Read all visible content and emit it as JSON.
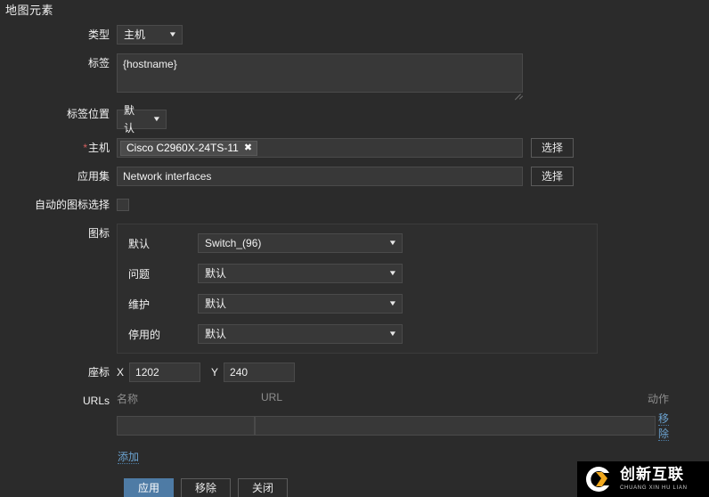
{
  "page": {
    "title": "地图元素"
  },
  "form": {
    "type": {
      "label": "类型",
      "value": "主机"
    },
    "label_field": {
      "label": "标签",
      "value": "{hostname}"
    },
    "label_position": {
      "label": "标签位置",
      "value": "默认"
    },
    "host": {
      "label": "主机",
      "required_marker": "*",
      "chip_value": "Cisco C2960X-24TS-11",
      "chip_remove": "✖",
      "select_button": "选择"
    },
    "application": {
      "label": "应用集",
      "value": "Network interfaces",
      "select_button": "选择"
    },
    "auto_icon": {
      "label": "自动的图标选择",
      "checked": false
    },
    "icons": {
      "label": "图标",
      "rows": [
        {
          "label": "默认",
          "value": "Switch_(96)"
        },
        {
          "label": "问题",
          "value": "默认"
        },
        {
          "label": "维护",
          "value": "默认"
        },
        {
          "label": "停用的",
          "value": "默认"
        }
      ]
    },
    "coordinates": {
      "label": "座标",
      "x_label": "X",
      "x_value": "1202",
      "y_label": "Y",
      "y_value": "240"
    },
    "urls": {
      "label": "URLs",
      "headers": {
        "name": "名称",
        "url": "URL",
        "action": "动作"
      },
      "rows": [
        {
          "name": "",
          "url": "",
          "remove": "移除"
        }
      ],
      "add_link": "添加"
    }
  },
  "footer": {
    "apply": "应用",
    "remove": "移除",
    "close": "关闭"
  },
  "watermark": {
    "cn": "创新互联",
    "en": "CHUANG XIN HU LIAN"
  },
  "colors": {
    "background": "#2b2b2b",
    "field_bg": "#383838",
    "field_border": "#4a4a4a",
    "text": "#f2f2f2",
    "muted": "#8e8e8e",
    "link": "#6ba2cf",
    "primary": "#4e7ba5",
    "required": "#d45f5f"
  }
}
